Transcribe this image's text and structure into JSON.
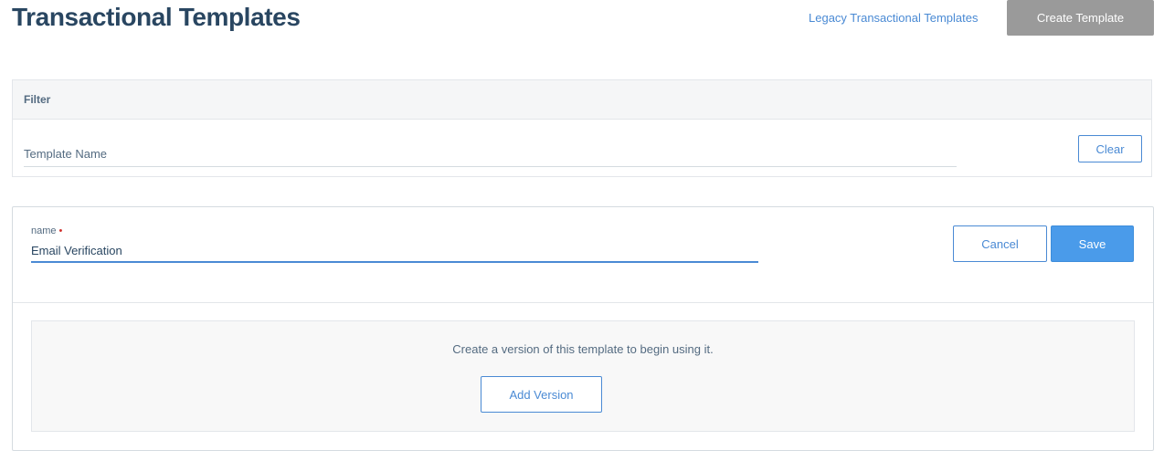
{
  "header": {
    "title": "Transactional Templates",
    "legacy_link": "Legacy Transactional Templates",
    "create_button": "Create Template"
  },
  "filter": {
    "heading": "Filter",
    "name_placeholder": "Template Name",
    "clear_button": "Clear"
  },
  "template_form": {
    "name_label": "name",
    "required_marker": "•",
    "name_value": "Email Verification",
    "cancel_button": "Cancel",
    "save_button": "Save"
  },
  "versions": {
    "empty_message": "Create a version of this template to begin using it.",
    "add_version_button": "Add Version"
  },
  "colors": {
    "title": "#294661",
    "link": "#4a8ad4",
    "primary": "#4a9bea",
    "disabled_button": "#9a9a9a",
    "required": "#d0312d"
  }
}
